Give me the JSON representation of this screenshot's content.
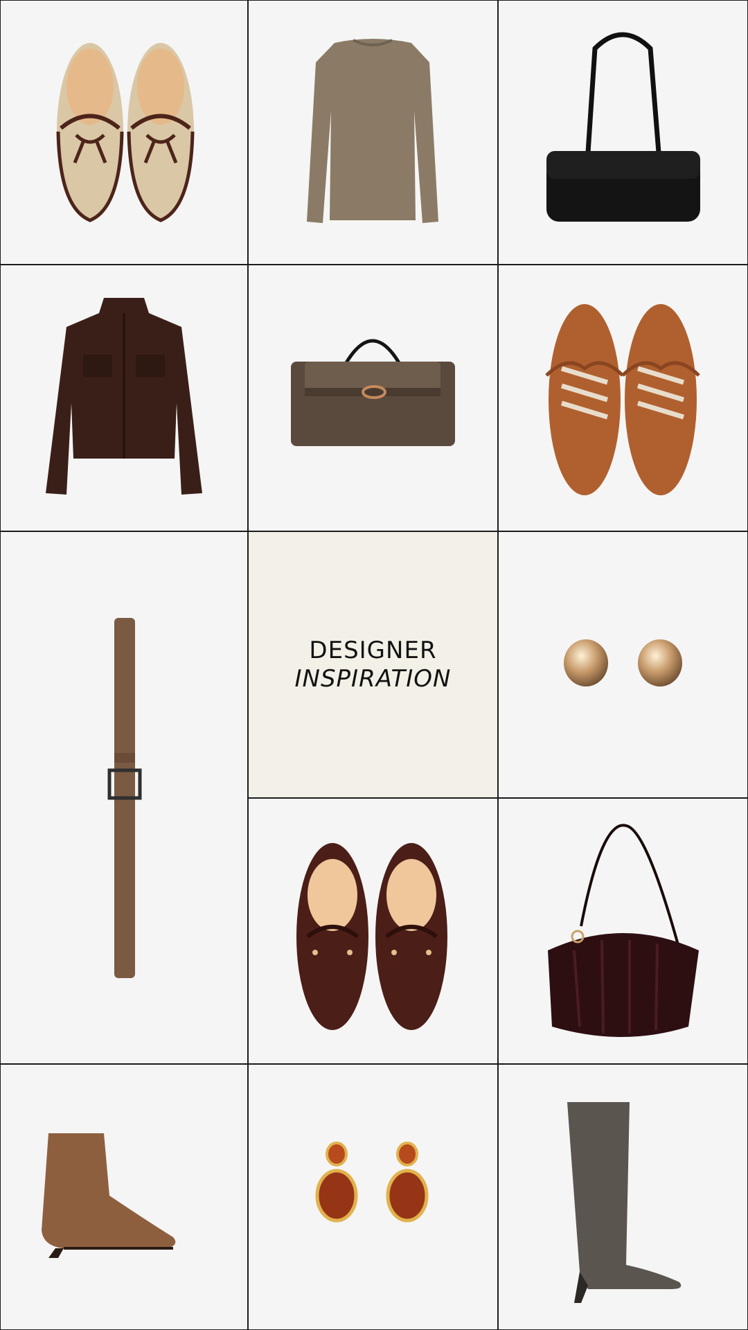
{
  "title": {
    "line1": "DESIGNER",
    "line2": "INSPIRATION"
  },
  "items": [
    {
      "name": "cream-bow-loafers",
      "icon": "loafer-pair-icon"
    },
    {
      "name": "taupe-knit-sweater",
      "icon": "sweater-icon"
    },
    {
      "name": "black-shoulder-bag",
      "icon": "shoulder-bag-icon"
    },
    {
      "name": "brown-leather-jacket",
      "icon": "jacket-icon"
    },
    {
      "name": "brown-suede-handbag",
      "icon": "handbag-icon"
    },
    {
      "name": "cognac-suede-sneakers",
      "icon": "sneaker-pair-icon"
    },
    {
      "name": "brown-suede-belt",
      "icon": "belt-icon"
    },
    {
      "name": "gold-dome-earrings",
      "icon": "earrings-icon"
    },
    {
      "name": "burgundy-leather-loafers",
      "icon": "loafer-pair-icon"
    },
    {
      "name": "burgundy-pleated-bag",
      "icon": "hobo-bag-icon"
    },
    {
      "name": "tan-suede-ankle-boot",
      "icon": "ankle-boot-icon"
    },
    {
      "name": "amber-drop-earrings",
      "icon": "drop-earrings-icon"
    },
    {
      "name": "grey-knee-high-boot",
      "icon": "tall-boot-icon"
    }
  ],
  "colors": {
    "background": "#f5f5f5",
    "grid_lines": "#1b1b1b",
    "title_panel": "#f3f1e7"
  }
}
